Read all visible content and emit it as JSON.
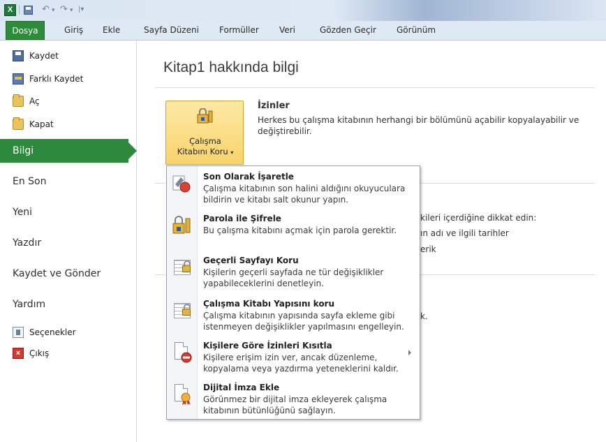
{
  "ribbon": {
    "tabs": [
      "Dosya",
      "Giriş",
      "Ekle",
      "Sayfa Düzeni",
      "Formüller",
      "Veri",
      "Gözden Geçir",
      "Görünüm"
    ]
  },
  "nav": {
    "small_items": [
      "Kaydet",
      "Farklı Kaydet",
      "Aç",
      "Kapat"
    ],
    "active": "Bilgi",
    "big_items": [
      "En Son",
      "Yeni",
      "Yazdır",
      "Kaydet ve Gönder",
      "Yardım"
    ],
    "bottom_items": [
      "Seçenekler",
      "Çıkış"
    ]
  },
  "main": {
    "title": "Kitap1 hakkında bilgi",
    "protect_button": {
      "line1": "Çalışma",
      "line2": "Kitabını Koru"
    },
    "permissions_title": "İzinler",
    "permissions_desc": "Herkes bu çalışma kitabının herhangi bir bölümünü açabilir kopyalayabilir ve değiştirebilir.",
    "partial_lines": [
      "kileri içerdiğine dikkat edin:",
      "ın adı ve ilgili tarihler",
      "erik",
      "k."
    ]
  },
  "menu": {
    "items": [
      {
        "title": "Son Olarak İşaretle",
        "desc": "Çalışma kitabının son halini aldığını okuyuculara bildirin ve kitabı salt okunur yapın.",
        "icon": "mark-final-icon"
      },
      {
        "title": "Parola ile Şifrele",
        "desc": "Bu çalışma kitabını açmak için parola gerektir.",
        "icon": "encrypt-password-icon"
      },
      {
        "title": "Geçerli Sayfayı Koru",
        "desc": "Kişilerin geçerli sayfada ne tür değişiklikler yapabileceklerini denetleyin.",
        "icon": "protect-sheet-icon"
      },
      {
        "title": "Çalışma Kitabı Yapısını koru",
        "desc": "Çalışma kitabının yapısında sayfa ekleme gibi istenmeyen değişiklikler yapılmasını engelleyin.",
        "icon": "protect-structure-icon"
      },
      {
        "title": "Kişilere Göre İzinleri Kısıtla",
        "desc": "Kişilere erişim izin ver, ancak düzenleme, kopyalama veya yazdırma yeteneklerini kaldır.",
        "icon": "restrict-permission-icon"
      },
      {
        "title": "Dijital İmza Ekle",
        "desc": "Görünmez bir dijital imza ekleyerek çalışma kitabının bütünlüğünü sağlayın.",
        "icon": "digital-signature-icon"
      }
    ]
  },
  "colors": {
    "file_tab": "#2c8c3a",
    "active_nav": "#2d8a3c",
    "protect_button": "#f9d36b"
  }
}
